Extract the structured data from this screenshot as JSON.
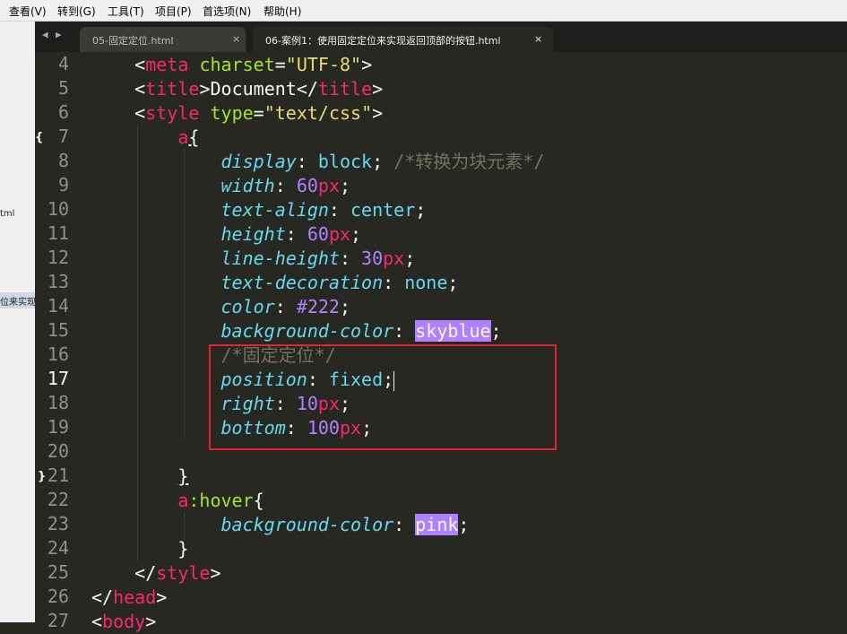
{
  "menubar": {
    "items": [
      "查看(V)",
      "转到(G)",
      "工具(T)",
      "项目(P)",
      "首选项(N)",
      "帮助(H)"
    ]
  },
  "sidebar": {
    "fragments": [
      "tml",
      "位来实现"
    ]
  },
  "tabs": [
    {
      "label": "05-固定定位.html",
      "close": "×",
      "active": false
    },
    {
      "label": "06-案例1：使用固定定位来实现返回顶部的按钮.html",
      "close": "×",
      "active": true
    }
  ],
  "nav": {
    "back": "◀",
    "forward": "▶"
  },
  "editor": {
    "current_line": "17",
    "line_numbers": [
      "4",
      "5",
      "6",
      "7",
      "8",
      "9",
      "10",
      "11",
      "12",
      "13",
      "14",
      "15",
      "16",
      "17",
      "18",
      "19",
      "20",
      "21",
      "22",
      "23",
      "24",
      "25",
      "26",
      "27"
    ],
    "fold_markers": {
      "open": "{",
      "close": "}"
    },
    "lines": {
      "l4": {
        "tag": "meta",
        "attr": "charset",
        "val": "\"UTF-8\""
      },
      "l5": {
        "tag": "title",
        "text": "Document"
      },
      "l6": {
        "tag": "style",
        "attr": "type",
        "val": "\"text/css\""
      },
      "l7": {
        "selector": "a"
      },
      "l8": {
        "prop": "display",
        "value": "block",
        "comment": "/*转换为块元素*/"
      },
      "l9": {
        "prop": "width",
        "num": "60",
        "unit": "px"
      },
      "l10": {
        "prop": "text-align",
        "value": "center"
      },
      "l11": {
        "prop": "height",
        "num": "60",
        "unit": "px"
      },
      "l12": {
        "prop": "line-height",
        "num": "30",
        "unit": "px"
      },
      "l13": {
        "prop": "text-decoration",
        "value": "none"
      },
      "l14": {
        "prop": "color",
        "value": "#222"
      },
      "l15": {
        "prop": "background-color",
        "value": "skyblue"
      },
      "l16": {
        "comment": "/*固定定位*/"
      },
      "l17": {
        "prop": "position",
        "value": "fixed"
      },
      "l18": {
        "prop": "right",
        "num": "10",
        "unit": "px"
      },
      "l19": {
        "prop": "bottom",
        "num": "100",
        "unit": "px"
      },
      "l22": {
        "selector": "a",
        "pseudo": ":hover"
      },
      "l23": {
        "prop": "background-color",
        "value": "pink"
      },
      "l25": {
        "tag": "style"
      },
      "l26": {
        "tag": "head"
      },
      "l27": {
        "tag": "body"
      }
    }
  },
  "colors": {
    "background": "#272822",
    "tag": "#f92672",
    "attr": "#a6e22e",
    "string": "#e6db74",
    "property": "#66d9ef",
    "number": "#ae81ff",
    "comment": "#75715e",
    "highlight_box": "#e0262a"
  }
}
